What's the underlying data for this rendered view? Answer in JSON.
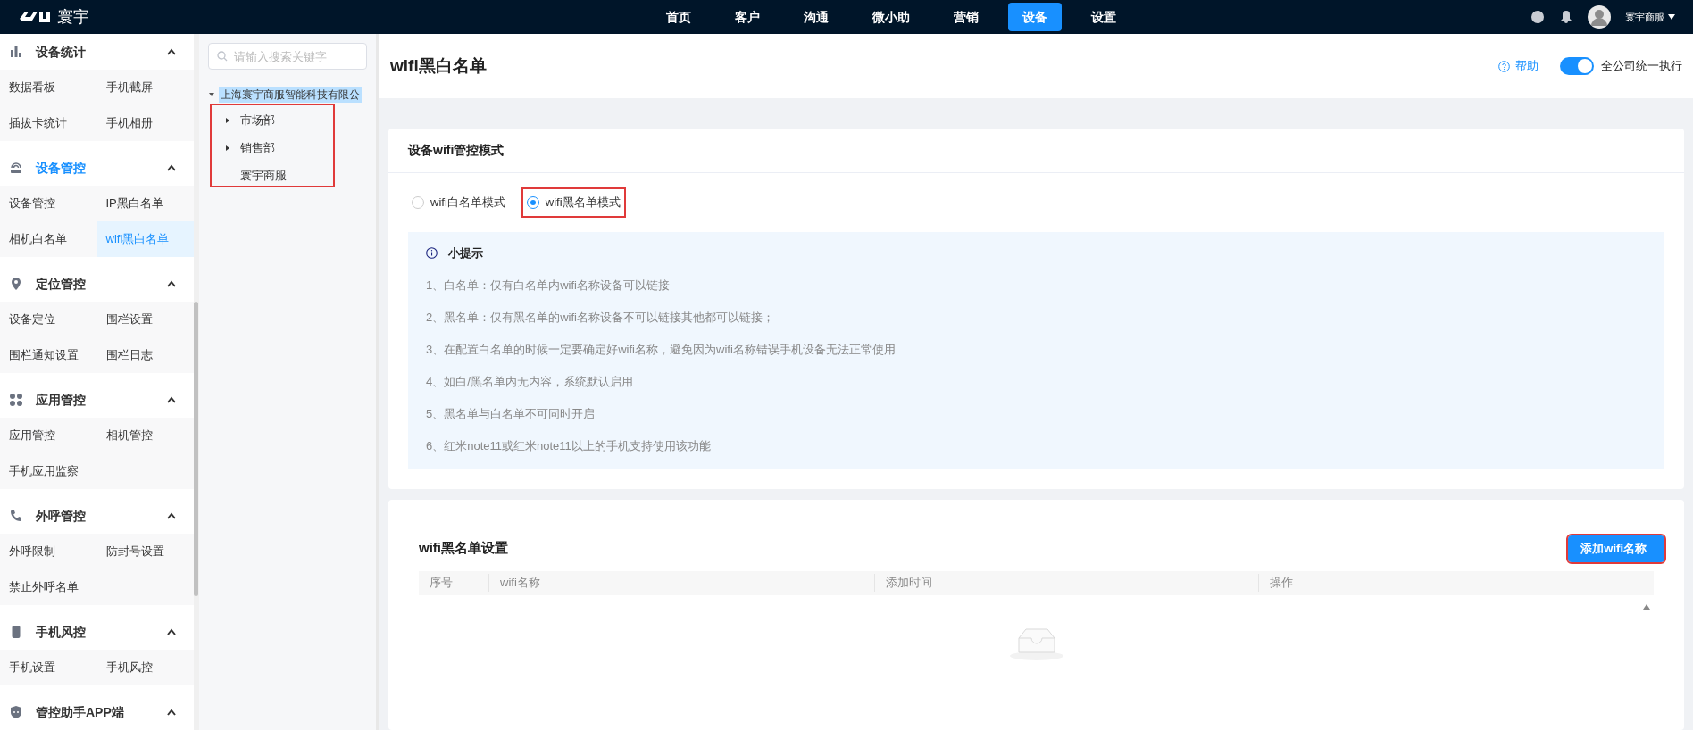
{
  "top_bar": {
    "logo_text": "寰宇",
    "nav": [
      {
        "label": "首页",
        "selected": false
      },
      {
        "label": "客户",
        "selected": false
      },
      {
        "label": "沟通",
        "selected": false
      },
      {
        "label": "微小助",
        "selected": false
      },
      {
        "label": "营销",
        "selected": false
      },
      {
        "label": "设备",
        "selected": true
      },
      {
        "label": "设置",
        "selected": false
      }
    ],
    "user": "寰宇商服"
  },
  "sidebar": {
    "sections": [
      {
        "title": "设备统计",
        "selected": false,
        "expanded": true,
        "items": [
          {
            "label": "数据看板",
            "selected": false
          },
          {
            "label": "手机截屏",
            "selected": false
          },
          {
            "label": "插拔卡统计",
            "selected": false
          },
          {
            "label": "手机相册",
            "selected": false
          }
        ]
      },
      {
        "title": "设备管控",
        "selected": true,
        "expanded": true,
        "items": [
          {
            "label": "设备管控",
            "selected": false
          },
          {
            "label": "IP黑白名单",
            "selected": false
          },
          {
            "label": "相机白名单",
            "selected": false
          },
          {
            "label": "wifi黑白名单",
            "selected": true
          }
        ]
      },
      {
        "title": "定位管控",
        "selected": false,
        "expanded": true,
        "items": [
          {
            "label": "设备定位",
            "selected": false
          },
          {
            "label": "围栏设置",
            "selected": false
          },
          {
            "label": "围栏通知设置",
            "selected": false
          },
          {
            "label": "围栏日志",
            "selected": false
          }
        ]
      },
      {
        "title": "应用管控",
        "selected": false,
        "expanded": true,
        "items": [
          {
            "label": "应用管控",
            "selected": false
          },
          {
            "label": "相机管控",
            "selected": false
          },
          {
            "label": "手机应用监察",
            "selected": false
          }
        ]
      },
      {
        "title": "外呼管控",
        "selected": false,
        "expanded": true,
        "items": [
          {
            "label": "外呼限制",
            "selected": false
          },
          {
            "label": "防封号设置",
            "selected": false
          },
          {
            "label": "禁止外呼名单",
            "selected": false
          }
        ]
      },
      {
        "title": "手机风控",
        "selected": false,
        "expanded": true,
        "items": [
          {
            "label": "手机设置",
            "selected": false
          },
          {
            "label": "手机风控",
            "selected": false
          }
        ]
      },
      {
        "title": "管控助手APP端",
        "selected": false,
        "expanded": true
      }
    ]
  },
  "tree": {
    "search": {
      "placeholder": "请输入搜索关键字"
    },
    "nodes": [
      {
        "label": "上海寰宇商服智能科技有限公",
        "selected": true,
        "expanded": true,
        "children": [
          {
            "label": "市场部",
            "selected": false,
            "expanded": false,
            "has_children": true
          },
          {
            "label": "销售部",
            "selected": false,
            "expanded": false,
            "has_children": true
          },
          {
            "label": "寰宇商服",
            "selected": false,
            "has_children": false
          }
        ]
      }
    ]
  },
  "header": {
    "title": "wifi黑白名单",
    "help": "帮助",
    "company_toggle": {
      "label": "全公司统一执行",
      "on": true
    }
  },
  "mode_card": {
    "title": "设备wifi管控模式",
    "options": [
      {
        "label": "wifi白名单模式",
        "selected": false
      },
      {
        "label": "wifi黑名单模式",
        "selected": true
      }
    ],
    "tips": {
      "title": "小提示",
      "lines": [
        "1、白名单：仅有白名单内wifi名称设备可以链接",
        "2、黑名单：仅有黑名单的wifi名称设备不可以链接其他都可以链接；",
        "3、在配置白名单的时候一定要确定好wifi名称，避免因为wifi名称错误手机设备无法正常使用",
        "4、如白/黑名单内无内容，系统默认启用",
        "5、黑名单与白名单不可同时开启",
        "6、红米note11或红米note11以上的手机支持使用该功能"
      ]
    }
  },
  "list_card": {
    "title": "wifi黑名单设置",
    "add_button": "添加wifi名称",
    "table": {
      "columns": [
        "序号",
        "wifi名称",
        "添加时间",
        "操作"
      ]
    }
  }
}
